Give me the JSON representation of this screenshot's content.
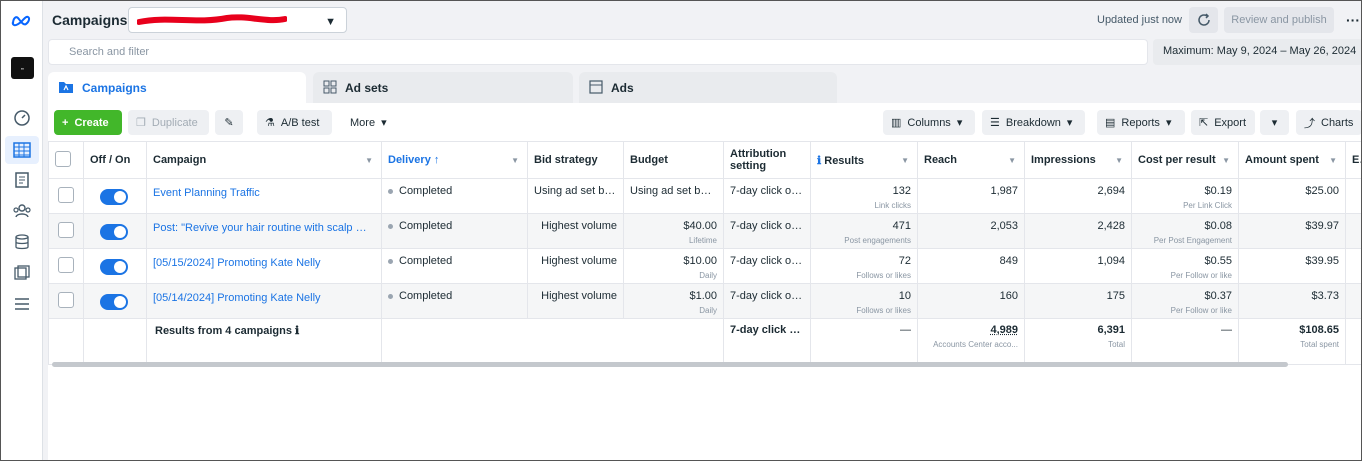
{
  "header": {
    "title": "Campaigns",
    "updated": "Updated just now",
    "review_publish": "Review and publish",
    "more": "···"
  },
  "search": {
    "placeholder": "Search and filter"
  },
  "date_range": "Maximum: May 9, 2024 – May 26, 2024",
  "tabs": [
    {
      "label": "Campaigns",
      "icon": "campaign-folder-icon"
    },
    {
      "label": "Ad sets",
      "icon": "adsets-grid-icon"
    },
    {
      "label": "Ads",
      "icon": "ad-card-icon"
    }
  ],
  "toolbar": {
    "create": "Create",
    "duplicate": "Duplicate",
    "ab_test": "A/B test",
    "more": "More",
    "columns": "Columns",
    "breakdown": "Breakdown",
    "reports": "Reports",
    "export": "Export",
    "charts": "Charts"
  },
  "columns": {
    "off_on": "Off / On",
    "campaign": "Campaign",
    "delivery": "Delivery",
    "bid_strategy": "Bid strategy",
    "budget": "Budget",
    "attribution": "Attribution setting",
    "results": "Results",
    "reach": "Reach",
    "impressions": "Impressions",
    "cost_per_result": "Cost per result",
    "amount_spent": "Amount spent",
    "ends": "En"
  },
  "rows": [
    {
      "campaign": "Event Planning Traffic",
      "delivery": "Completed",
      "bid": "Using ad set bid ...",
      "budget": "Using ad set bud...",
      "budget_sub": "",
      "attribution": "7-day click or 1...",
      "results": "132",
      "results_sub": "Link clicks",
      "reach": "1,987",
      "impressions": "2,694",
      "cpr": "$0.19",
      "cpr_sub": "Per Link Click",
      "spent": "$25.00"
    },
    {
      "campaign": "Post: \"Revive your hair routine with scalp massa...",
      "delivery": "Completed",
      "bid": "Highest volume",
      "budget": "$40.00",
      "budget_sub": "Lifetime",
      "attribution": "7-day click or 1...",
      "results": "471",
      "results_sub": "Post engagements",
      "reach": "2,053",
      "impressions": "2,428",
      "cpr": "$0.08",
      "cpr_sub": "Per Post Engagement",
      "spent": "$39.97"
    },
    {
      "campaign": "[05/15/2024] Promoting Kate Nelly",
      "delivery": "Completed",
      "bid": "Highest volume",
      "budget": "$10.00",
      "budget_sub": "Daily",
      "attribution": "7-day click or 1...",
      "results": "72",
      "results_sub": "Follows or likes",
      "reach": "849",
      "impressions": "1,094",
      "cpr": "$0.55",
      "cpr_sub": "Per Follow or like",
      "spent": "$39.95"
    },
    {
      "campaign": "[05/14/2024] Promoting Kate Nelly",
      "delivery": "Completed",
      "bid": "Highest volume",
      "budget": "$1.00",
      "budget_sub": "Daily",
      "attribution": "7-day click or 1...",
      "results": "10",
      "results_sub": "Follows or likes",
      "reach": "160",
      "impressions": "175",
      "cpr": "$0.37",
      "cpr_sub": "Per Follow or like",
      "spent": "$3.73"
    }
  ],
  "totals": {
    "label": "Results from 4 campaigns",
    "attribution": "7-day click or ...",
    "results": "—",
    "reach": "4,989",
    "reach_sub": "Accounts Center acco...",
    "impressions": "6,391",
    "impressions_sub": "Total",
    "cpr": "—",
    "spent": "$108.65",
    "spent_sub": "Total spent"
  },
  "colors": {
    "accent": "#1b74e4",
    "create": "#42b72a"
  }
}
